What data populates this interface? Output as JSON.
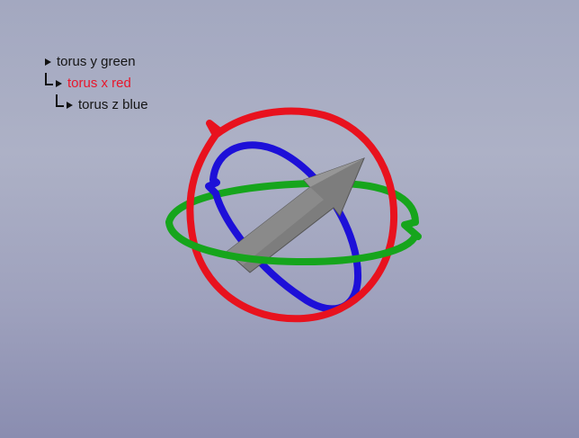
{
  "hierarchy": {
    "items": [
      {
        "label": "torus y green",
        "color": "#151515"
      },
      {
        "label": "torus x red",
        "color": "#e8162b"
      },
      {
        "label": "torus z blue",
        "color": "#151515"
      }
    ]
  },
  "scene": {
    "objects": [
      {
        "name": "torus y",
        "color": "#16a51c"
      },
      {
        "name": "torus x",
        "color": "#e8121e"
      },
      {
        "name": "torus z",
        "color": "#1d10d8"
      },
      {
        "name": "direction arrow",
        "color": "#7d7d7d"
      }
    ]
  }
}
